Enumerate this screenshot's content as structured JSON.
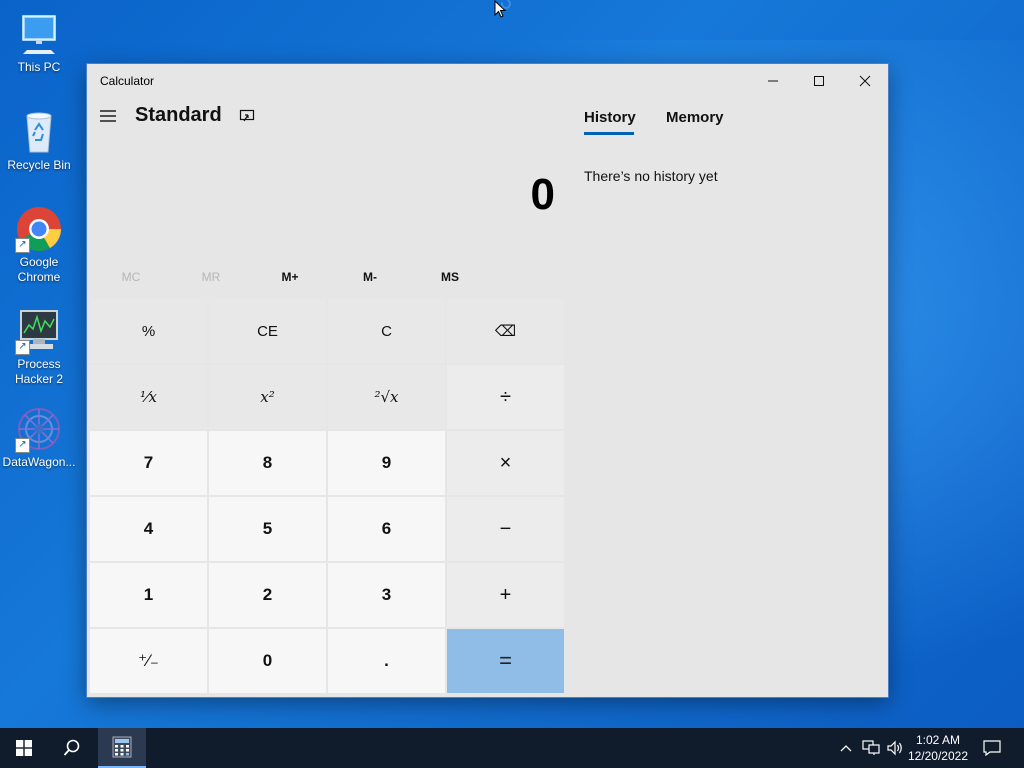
{
  "desktop": {
    "icons": [
      {
        "label_1": "This PC",
        "label_2": "",
        "icon": "this-pc-icon"
      },
      {
        "label_1": "Recycle Bin",
        "label_2": "",
        "icon": "recycle-bin-icon"
      },
      {
        "label_1": "Google",
        "label_2": "Chrome",
        "icon": "chrome-icon"
      },
      {
        "label_1": "Process",
        "label_2": "Hacker 2",
        "icon": "process-hacker-icon"
      },
      {
        "label_1": "DataWagon...",
        "label_2": "",
        "icon": "datawagon-icon"
      }
    ]
  },
  "window": {
    "title": "Calculator",
    "controls": [
      "minimize-icon",
      "maximize-icon",
      "close-icon"
    ]
  },
  "calculator": {
    "mode": "Standard",
    "display": "0",
    "memory": [
      "MC",
      "MR",
      "M+",
      "M-",
      "MS"
    ],
    "keys": [
      [
        "%",
        "CE",
        "C",
        "⌫"
      ],
      [
        "¹⁄x",
        "x²",
        "²√x",
        "÷"
      ],
      [
        "7",
        "8",
        "9",
        "×"
      ],
      [
        "4",
        "5",
        "6",
        "−"
      ],
      [
        "1",
        "2",
        "3",
        "+"
      ],
      [
        "⁺⁄₋",
        "0",
        ".",
        "="
      ]
    ]
  },
  "history_panel": {
    "tabs": [
      "History",
      "Memory"
    ],
    "active_tab": "History",
    "empty_message": "There’s no history yet"
  },
  "taskbar": {
    "time": "1:02 AM",
    "date": "12/20/2022"
  },
  "colors": {
    "accent": "#0063b1",
    "equals_key": "#8fbde8",
    "desktop": "#0a63c9",
    "taskbar": "#101c2c"
  }
}
